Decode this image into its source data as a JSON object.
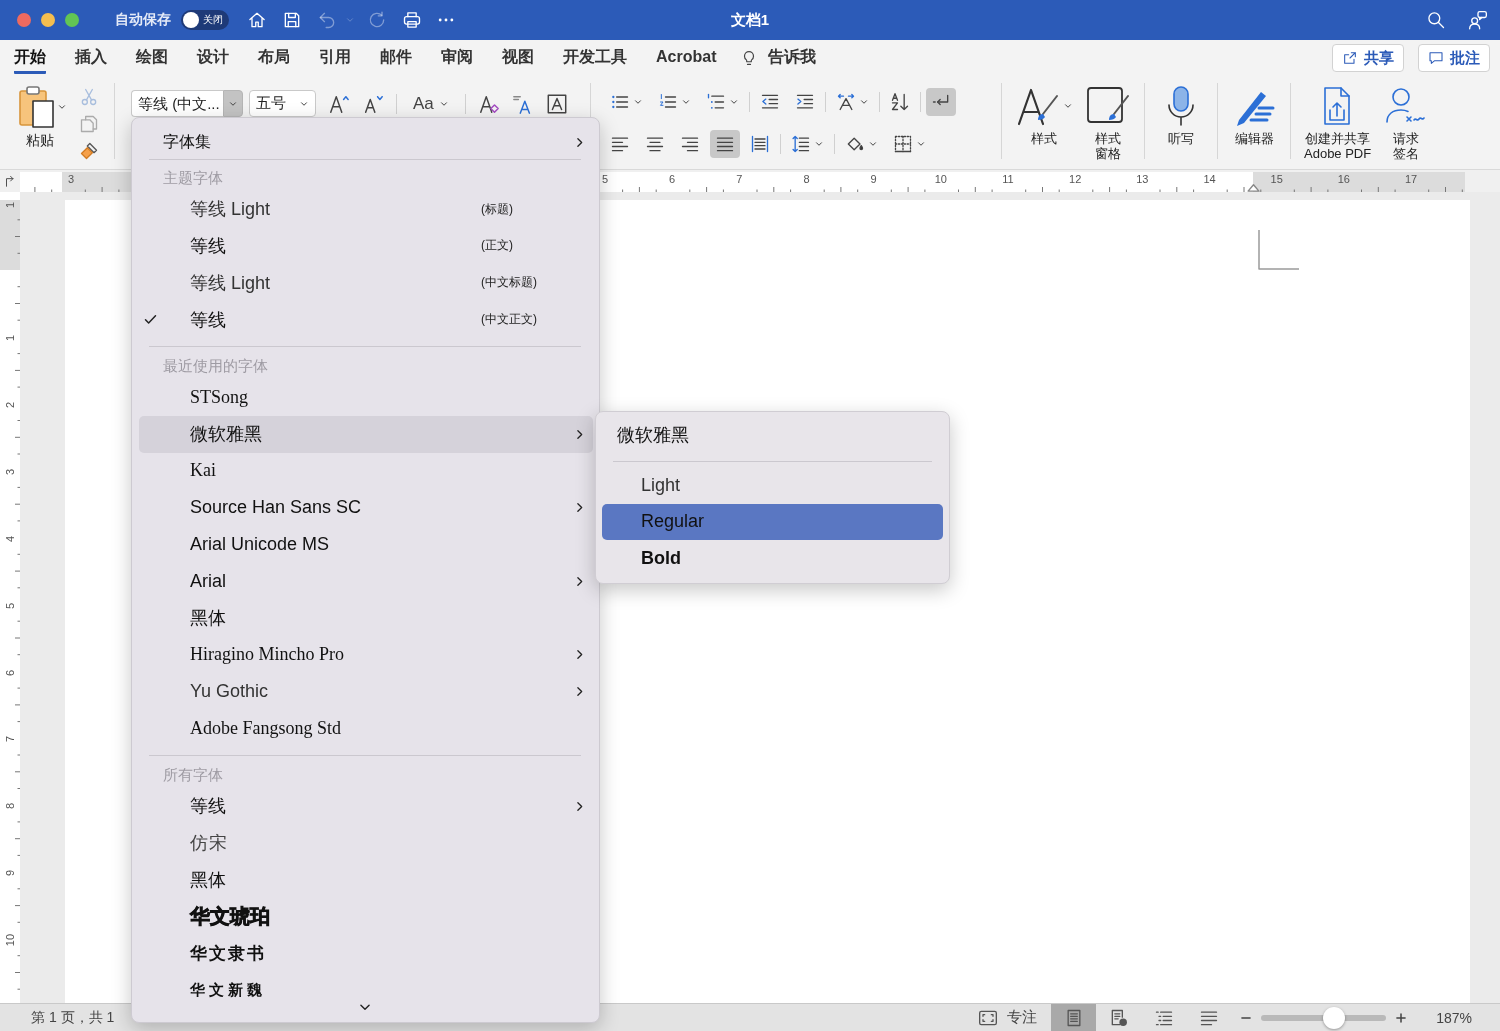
{
  "autosave": {
    "label": "自动保存",
    "on": false,
    "state_text": "关闭"
  },
  "quick_access": [
    {
      "kind": "home",
      "disabled": false
    },
    {
      "kind": "save",
      "disabled": false
    },
    {
      "kind": "undo",
      "disabled": true
    },
    {
      "kind": "caret",
      "disabled": true
    },
    {
      "kind": "redo",
      "disabled": true
    },
    {
      "kind": "print",
      "disabled": false
    },
    {
      "kind": "more",
      "disabled": false
    }
  ],
  "window": {
    "title": "文档1"
  },
  "tabs": [
    {
      "label": "开始",
      "selected": true
    },
    {
      "label": "插入",
      "selected": false
    },
    {
      "label": "绘图",
      "selected": false
    },
    {
      "label": "设计",
      "selected": false
    },
    {
      "label": "布局",
      "selected": false
    },
    {
      "label": "引用",
      "selected": false
    },
    {
      "label": "邮件",
      "selected": false
    },
    {
      "label": "审阅",
      "selected": false
    },
    {
      "label": "视图",
      "selected": false
    },
    {
      "label": "开发工具",
      "selected": false
    },
    {
      "label": "Acrobat",
      "selected": false
    }
  ],
  "tell_me": {
    "label": "告诉我"
  },
  "share_button": {
    "label": "共享"
  },
  "comments_button": {
    "label": "批注"
  },
  "ribbon": {
    "paste": {
      "label": "粘贴"
    },
    "clipboard_tools": [
      {
        "kind": "cut",
        "disabled": true
      },
      {
        "kind": "copy",
        "disabled": true
      },
      {
        "kind": "format-painter",
        "disabled": false
      }
    ],
    "font_name": {
      "value": "等线 (中文..."
    },
    "font_size": {
      "value": "五号"
    },
    "change_case": {
      "label": "Aa"
    },
    "paragraph_rows": [
      [
        [
          {
            "kind": "bullets",
            "dropdown": true,
            "selected": false
          },
          {
            "kind": "numbering",
            "dropdown": true,
            "selected": false
          },
          {
            "kind": "multilevel",
            "dropdown": true,
            "selected": false
          }
        ],
        [
          {
            "kind": "outdent",
            "dropdown": false,
            "selected": false
          },
          {
            "kind": "indent",
            "dropdown": false,
            "selected": false
          }
        ],
        [
          {
            "kind": "asian-layout",
            "dropdown": true,
            "selected": false
          }
        ],
        [
          {
            "kind": "sort",
            "dropdown": false,
            "selected": false
          }
        ],
        [
          {
            "kind": "show-marks",
            "dropdown": false,
            "selected": true
          }
        ]
      ],
      [
        [
          {
            "kind": "align-left",
            "dropdown": false,
            "selected": false
          },
          {
            "kind": "align-center",
            "dropdown": false,
            "selected": false
          },
          {
            "kind": "align-right",
            "dropdown": false,
            "selected": false
          },
          {
            "kind": "justify",
            "dropdown": false,
            "selected": true
          },
          {
            "kind": "distributed",
            "dropdown": false,
            "selected": false
          }
        ],
        [
          {
            "kind": "line-spacing",
            "dropdown": true,
            "selected": false
          }
        ],
        [
          {
            "kind": "shading",
            "dropdown": true,
            "selected": false
          },
          {
            "kind": "borders",
            "dropdown": true,
            "selected": false
          }
        ]
      ]
    ],
    "large_groups": [
      [
        {
          "kind": "styles",
          "lines": [
            "样式"
          ],
          "dropdown": true
        },
        {
          "kind": "styles-pane",
          "lines": [
            "样式",
            "窗格"
          ],
          "dropdown": false
        }
      ],
      [
        {
          "kind": "dictate",
          "lines": [
            "听写"
          ],
          "dropdown": false
        }
      ],
      [
        {
          "kind": "editor",
          "lines": [
            "编辑器"
          ],
          "dropdown": false
        }
      ],
      [
        {
          "kind": "pdf",
          "lines": [
            "创建并共享",
            "Adobe PDF"
          ],
          "dropdown": false
        },
        {
          "kind": "sign",
          "lines": [
            "请求",
            "签名"
          ],
          "dropdown": false
        }
      ]
    ]
  },
  "ruler": {
    "left_marks": [
      "3"
    ],
    "marks": [
      "5",
      "6",
      "7",
      "8",
      "9",
      "10",
      "11",
      "12",
      "13",
      "14",
      "15",
      "16",
      "17"
    ]
  },
  "vertical_ruler": {
    "top_marks": [
      "1"
    ],
    "marks": [
      "1",
      "2",
      "3",
      "4",
      "5",
      "6",
      "7",
      "8",
      "9",
      "10"
    ]
  },
  "font_menu": {
    "sections": [
      {
        "items": [
          {
            "label": "字体集",
            "kind": "command",
            "checked": false,
            "submenu": true,
            "selected": false
          }
        ]
      },
      {
        "header": "主题字体",
        "items": [
          {
            "label": "等线 Light",
            "note": "(标题)",
            "kind": "light",
            "checked": false,
            "submenu": false,
            "selected": false
          },
          {
            "label": "等线",
            "note": "(正文)",
            "kind": "regular",
            "checked": false,
            "submenu": false,
            "selected": false
          },
          {
            "label": "等线 Light",
            "note": "(中文标题)",
            "kind": "light",
            "checked": false,
            "submenu": false,
            "selected": false
          },
          {
            "label": "等线",
            "note": "(中文正文)",
            "kind": "regular",
            "checked": true,
            "submenu": false,
            "selected": false
          }
        ]
      },
      {
        "header": "最近使用的字体",
        "items": [
          {
            "label": "STSong",
            "kind": "serif",
            "checked": false,
            "submenu": false,
            "selected": false
          },
          {
            "label": "微软雅黑",
            "kind": "regular",
            "checked": false,
            "submenu": true,
            "selected": true
          },
          {
            "label": "Kai",
            "kind": "serif",
            "checked": false,
            "submenu": false,
            "selected": false
          },
          {
            "label": "Source Han Sans SC",
            "kind": "regular",
            "checked": false,
            "submenu": true,
            "selected": false
          },
          {
            "label": "Arial Unicode MS",
            "kind": "regular",
            "checked": false,
            "submenu": false,
            "selected": false
          },
          {
            "label": "Arial",
            "kind": "regular",
            "checked": false,
            "submenu": true,
            "selected": false
          },
          {
            "label": "黑体",
            "kind": "regular",
            "checked": false,
            "submenu": false,
            "selected": false
          },
          {
            "label": "Hiragino Mincho Pro",
            "kind": "serif",
            "checked": false,
            "submenu": true,
            "selected": false
          },
          {
            "label": "Yu Gothic",
            "kind": "light",
            "checked": false,
            "submenu": true,
            "selected": false
          },
          {
            "label": "Adobe Fangsong Std",
            "kind": "serif",
            "checked": false,
            "submenu": false,
            "selected": false
          }
        ]
      },
      {
        "header": "所有字体",
        "items": [
          {
            "label": "等线",
            "kind": "regular",
            "checked": false,
            "submenu": true,
            "selected": false
          },
          {
            "label": "仿宋",
            "kind": "thin",
            "checked": false,
            "submenu": false,
            "selected": false
          },
          {
            "label": "黑体",
            "kind": "regular",
            "checked": false,
            "submenu": false,
            "selected": false
          },
          {
            "label": "华文琥珀",
            "kind": "heavy",
            "checked": false,
            "submenu": false,
            "selected": false
          },
          {
            "label": "华文隶书",
            "kind": "wide",
            "checked": false,
            "submenu": false,
            "selected": false
          },
          {
            "label": "华文新魏",
            "kind": "wider",
            "checked": false,
            "submenu": false,
            "selected": false
          }
        ]
      }
    ]
  },
  "style_submenu": {
    "title": "微软雅黑",
    "items": [
      {
        "label": "Light",
        "kind": "light",
        "selected": false
      },
      {
        "label": "Regular",
        "kind": "regular",
        "selected": true
      },
      {
        "label": "Bold",
        "kind": "bold",
        "selected": false
      }
    ]
  },
  "status_bar": {
    "page_info": "第 1 页，共 1",
    "focus": {
      "label": "专注"
    },
    "views": [
      {
        "kind": "print-layout",
        "selected": true
      },
      {
        "kind": "web-layout",
        "selected": false
      },
      {
        "kind": "outline",
        "selected": false
      },
      {
        "kind": "draft",
        "selected": false
      }
    ],
    "zoom": {
      "level": 0.58,
      "reading": "187%"
    }
  }
}
